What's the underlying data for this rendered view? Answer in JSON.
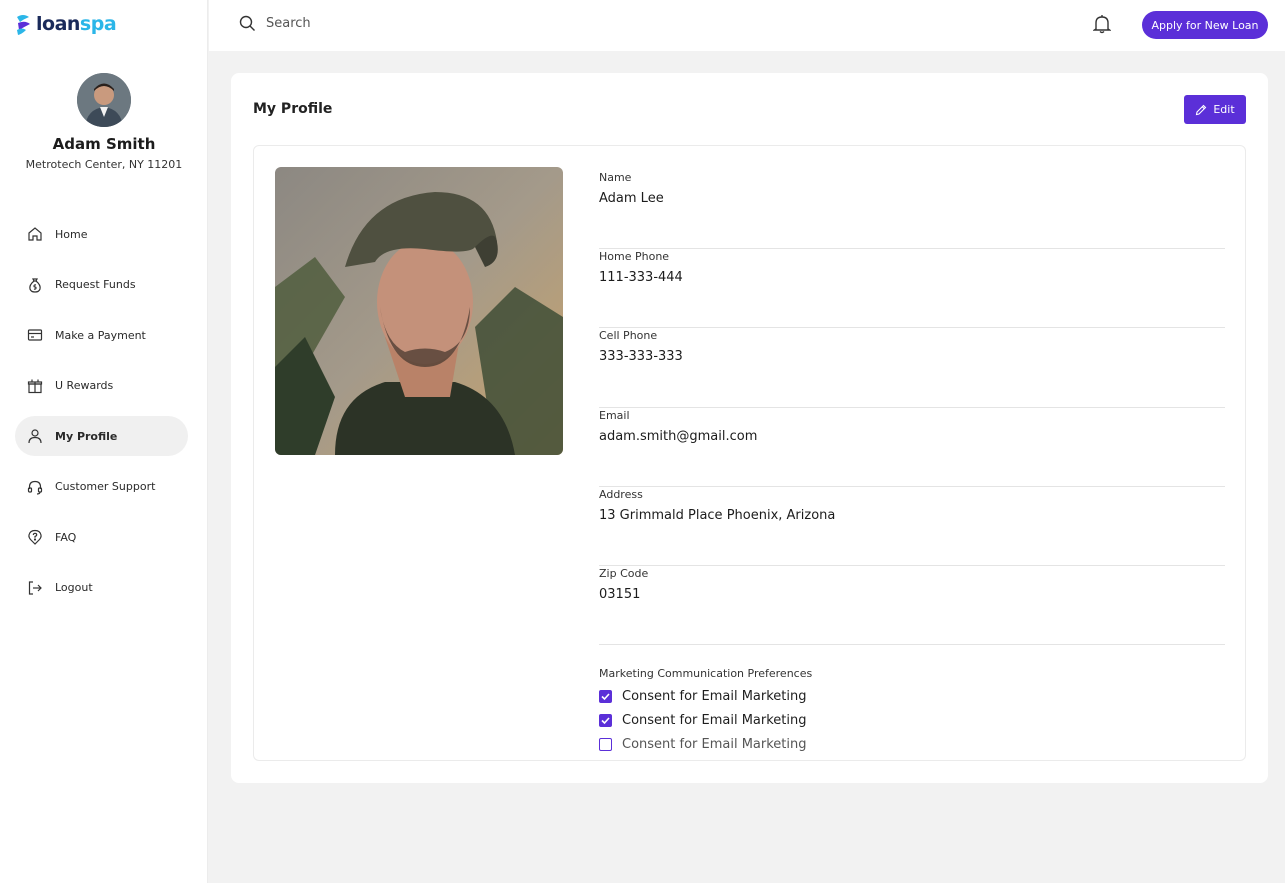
{
  "brand": {
    "logo_part1": "loan",
    "logo_part2": "spa",
    "accent": "#5b2fd8"
  },
  "user": {
    "name": "Adam Smith",
    "address": "Metrotech Center, NY 11201"
  },
  "nav": [
    {
      "label": "Home",
      "icon": "home-icon",
      "active": false
    },
    {
      "label": "Request Funds",
      "icon": "money-bag-icon",
      "active": false
    },
    {
      "label": "Make a Payment",
      "icon": "credit-card-icon",
      "active": false
    },
    {
      "label": "U Rewards",
      "icon": "gift-icon",
      "active": false
    },
    {
      "label": "My Profile",
      "icon": "user-icon",
      "active": true
    },
    {
      "label": "Customer Support",
      "icon": "headset-icon",
      "active": false
    },
    {
      "label": "FAQ",
      "icon": "question-icon",
      "active": false
    },
    {
      "label": "Logout",
      "icon": "logout-icon",
      "active": false
    }
  ],
  "header": {
    "search_placeholder": "Search",
    "apply_label": "Apply for New Loan"
  },
  "profile": {
    "title": "My Profile",
    "edit_label": "Edit",
    "fields": [
      {
        "label": "Name",
        "value": "Adam Lee"
      },
      {
        "label": "Home Phone",
        "value": "111-333-444"
      },
      {
        "label": "Cell Phone",
        "value": "333-333-333"
      },
      {
        "label": "Email",
        "value": "adam.smith@gmail.com"
      },
      {
        "label": "Address",
        "value": "13 Grimmald Place Phoenix, Arizona"
      },
      {
        "label": "Zip Code",
        "value": "03151"
      }
    ],
    "prefs_label": "Marketing Communication Preferences",
    "prefs": [
      {
        "label": "Consent for Email Marketing",
        "checked": true
      },
      {
        "label": "Consent for Email Marketing",
        "checked": true
      },
      {
        "label": "Consent for Email Marketing",
        "checked": false
      }
    ]
  }
}
